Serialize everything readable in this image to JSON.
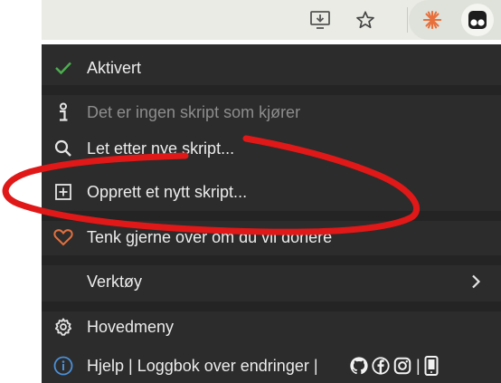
{
  "menu": {
    "enabled_label": "Aktivert",
    "no_scripts_label": "Det er ingen skript som kjører",
    "find_scripts_label": "Let etter nye skript...",
    "create_script_label": "Opprett et nytt skript...",
    "donate_label": "Tenk gjerne over om du vil donere",
    "tools_label": "Verktøy",
    "dashboard_label": "Hovedmeny",
    "help_label": "Hjelp | Loggbok over endringer |"
  },
  "colors": {
    "menu_bg": "#2c2c2c",
    "separator": "#242424",
    "check": "#4caf50",
    "heart": "#e07040",
    "info": "#4a90d9",
    "annotation": "#e01818",
    "toolbar_bg": "#e9ebe4"
  },
  "icons": {
    "install": "install-icon",
    "bookmark": "star-icon",
    "extension_sun": "sun-extension-icon",
    "tampermonkey": "tampermonkey-icon"
  }
}
